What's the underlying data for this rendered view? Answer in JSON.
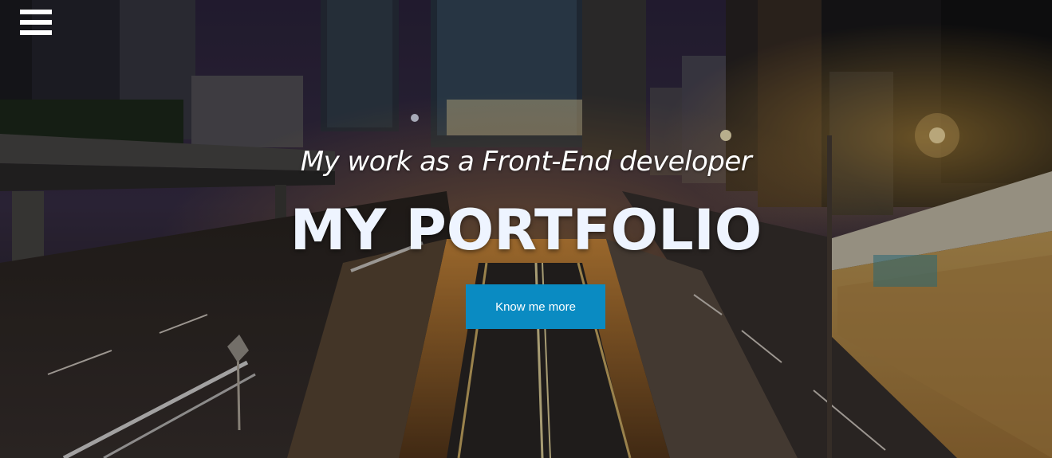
{
  "nav": {
    "menu_icon": "hamburger-menu-icon"
  },
  "hero": {
    "subtitle": "My work as a Front-End developer",
    "title": "MY PORTFOLIO",
    "cta_label": "Know me more",
    "background": "night-city-highway-photo"
  },
  "colors": {
    "cta_background": "#0a8bc2",
    "text": "#ffffff",
    "overlay": "#000000"
  }
}
